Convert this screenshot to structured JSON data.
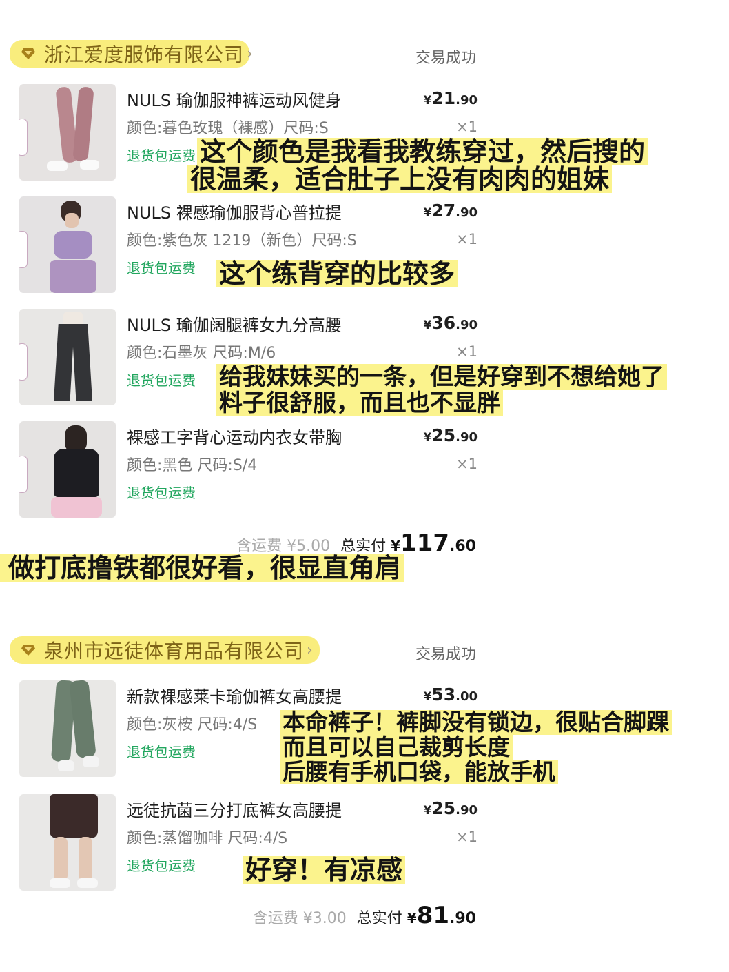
{
  "orders": [
    {
      "store": "浙江爱度服饰有限公司",
      "status": "交易成功",
      "items": [
        {
          "title": "NULS 瑜伽服神裤运动风健身",
          "price_cur": "¥",
          "price_int": "21",
          "price_dec": ".90",
          "spec": "颜色:暮色玫瑰（裸感）尺码:S",
          "qty": "×1",
          "refund": "退货包运费",
          "thumb_tag": "暮色玫瑰"
        },
        {
          "title": "NULS 裸感瑜伽服背心普拉提",
          "price_cur": "¥",
          "price_int": "27",
          "price_dec": ".90",
          "spec": "颜色:紫色灰 1219（新色）尺码:S",
          "qty": "×1",
          "refund": "退货包运费",
          "thumb_tag": "紫色灰"
        },
        {
          "title": "NULS 瑜伽阔腿裤女九分高腰",
          "price_cur": "¥",
          "price_int": "36",
          "price_dec": ".90",
          "spec": "颜色:石墨灰 尺码:M/6",
          "qty": "×1",
          "refund": "退货包运费",
          "thumb_tag": "石墨灰"
        },
        {
          "title": "裸感工字背心运动内衣女带胸",
          "price_cur": "¥",
          "price_int": "25",
          "price_dec": ".90",
          "spec": "颜色:黑色 尺码:S/4",
          "qty": "×1",
          "refund": "退货包运费",
          "thumb_tag": "黑色"
        }
      ],
      "shipping": "含运费 ¥5.00",
      "total_label": "总实付",
      "total_cur": "¥",
      "total_int": "117",
      "total_dec": ".60"
    },
    {
      "store": "泉州市远徒体育用品有限公司",
      "status": "交易成功",
      "items": [
        {
          "title": "新款裸感莱卡瑜伽裤女高腰提",
          "price_cur": "¥",
          "price_int": "53",
          "price_dec": ".00",
          "spec": "颜色:灰桉 尺码:4/S",
          "qty": "",
          "refund": "退货包运费"
        },
        {
          "title": "远徒抗菌三分打底裤女高腰提",
          "price_cur": "¥",
          "price_int": "25",
          "price_dec": ".90",
          "spec": "颜色:蒸馏咖啡 尺码:4/S",
          "qty": "×1",
          "refund": "退货包运费"
        }
      ],
      "shipping": "含运费 ¥3.00",
      "total_label": "总实付",
      "total_cur": "¥",
      "total_int": "81",
      "total_dec": ".90"
    }
  ],
  "notes": {
    "n1": [
      "这个颜色是我看我教练穿过，然后搜的",
      "很温柔，适合肚子上没有肉肉的姐妹"
    ],
    "n2": [
      "这个练背穿的比较多"
    ],
    "n3": [
      "给我妹妹买的一条，但是好穿到不想给她了",
      "料子很舒服，而且也不显胖"
    ],
    "n4": [
      "做打底撸铁都很好看，很显直角肩"
    ],
    "n5": [
      "本命裤子！裤脚没有锁边，很贴合脚踝",
      "而且可以自己裁剪长度",
      "后腰有手机口袋，能放手机"
    ],
    "n6": [
      "好穿！有凉感"
    ]
  },
  "colors": {
    "highlight": "#fbf38d",
    "store_text": "#7e6418",
    "refund_green": "#21a65e"
  }
}
